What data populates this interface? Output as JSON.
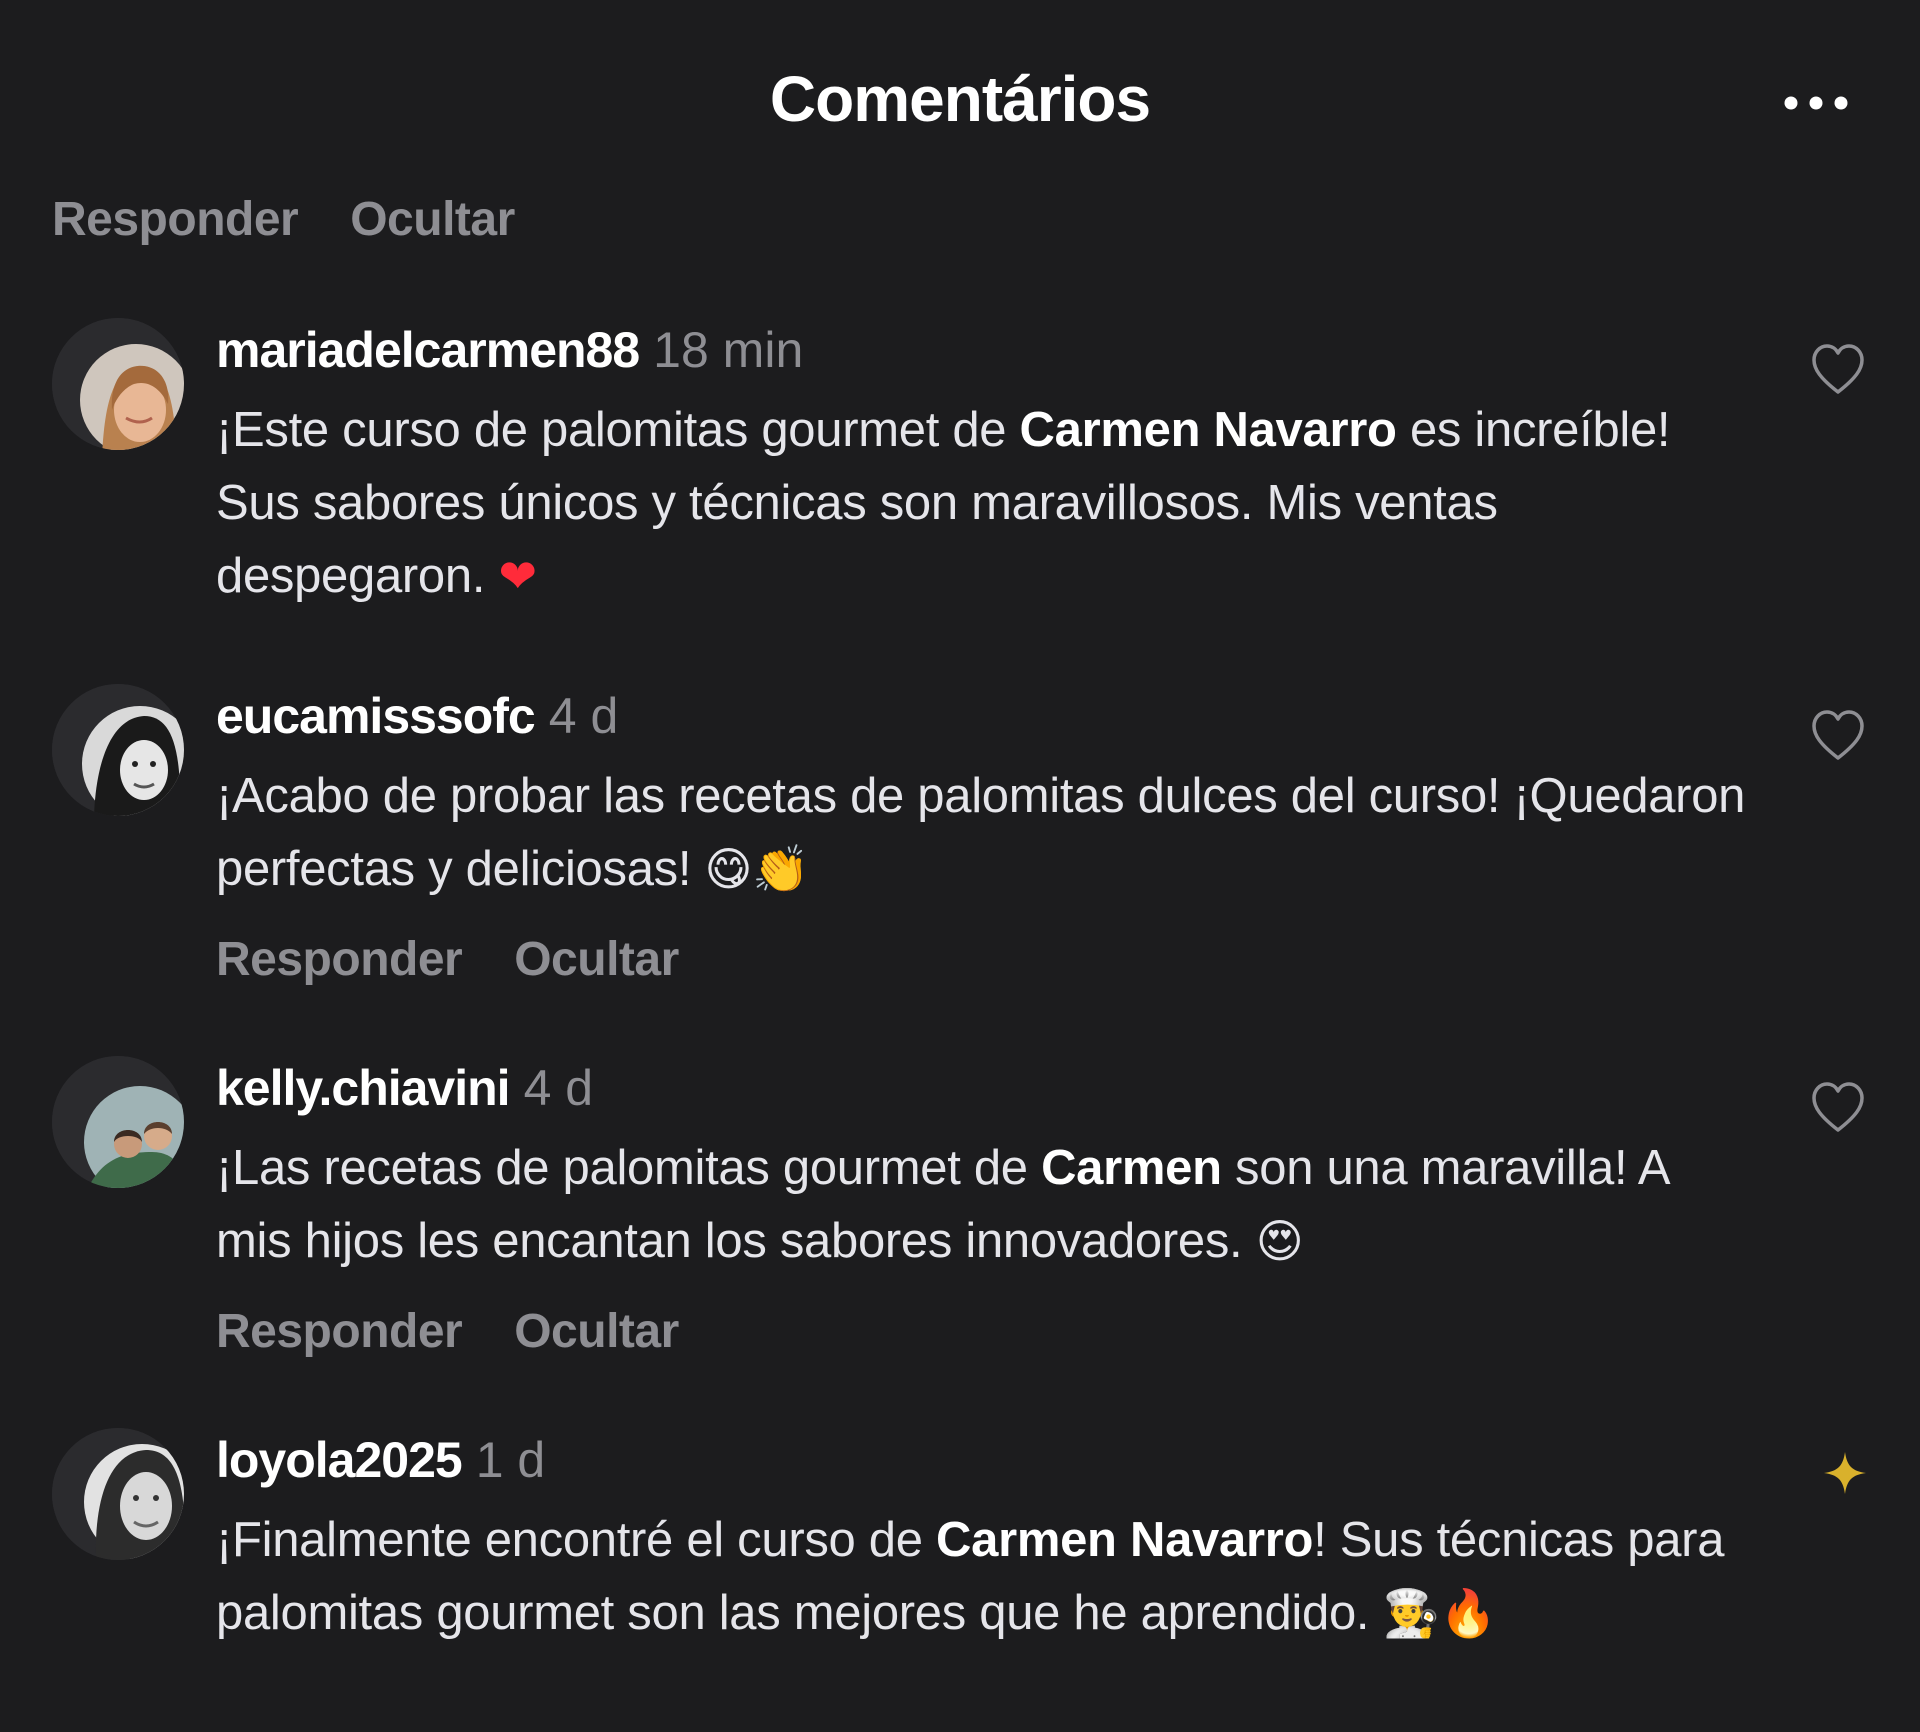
{
  "header": {
    "title": "Comentários"
  },
  "top_actions": {
    "reply": "Responder",
    "hide": "Ocultar"
  },
  "comments": [
    {
      "username": "mariadelcarmen88",
      "time": "18 min",
      "line1_a": "¡Este curso de palomitas gourmet de ",
      "line1_b": "Carmen Navarro",
      "line1_c": " es increíble!",
      "line2": "Sus sabores únicos y técnicas son maravillosos. Mis ventas",
      "line3": "despegaron. ",
      "emoji": "❤",
      "like_icon": "heart-outline-icon"
    },
    {
      "username": "eucamisssofc",
      "time": "4 d",
      "line1": "¡Acabo de probar las recetas de palomitas dulces del curso! ¡Quedaron",
      "line2": "perfectas y deliciosas! ",
      "emoji": "😋👏",
      "reply": "Responder",
      "hide": "Ocultar",
      "like_icon": "heart-outline-icon"
    },
    {
      "username": "kelly.chiavini",
      "time": "4 d",
      "line1_a": "¡Las recetas de palomitas gourmet de ",
      "line1_b": "Carmen",
      "line1_c": " son una maravilla! A",
      "line2": "mis hijos les encantan los sabores innovadores. ",
      "emoji": "😍",
      "reply": "Responder",
      "hide": "Ocultar",
      "like_icon": "heart-outline-icon"
    },
    {
      "username": "loyola2025",
      "time": "1 d",
      "line1_a": "¡Finalmente encontré el curso de ",
      "line1_b": "Carmen Navarro",
      "line1_c": "! Sus técnicas para",
      "line2": "palomitas gourmet son las mejores que he aprendido. ",
      "emoji": "👨‍🍳🔥",
      "badge_icon": "sparkle-icon",
      "badge_color": "#d9b12c"
    }
  ]
}
